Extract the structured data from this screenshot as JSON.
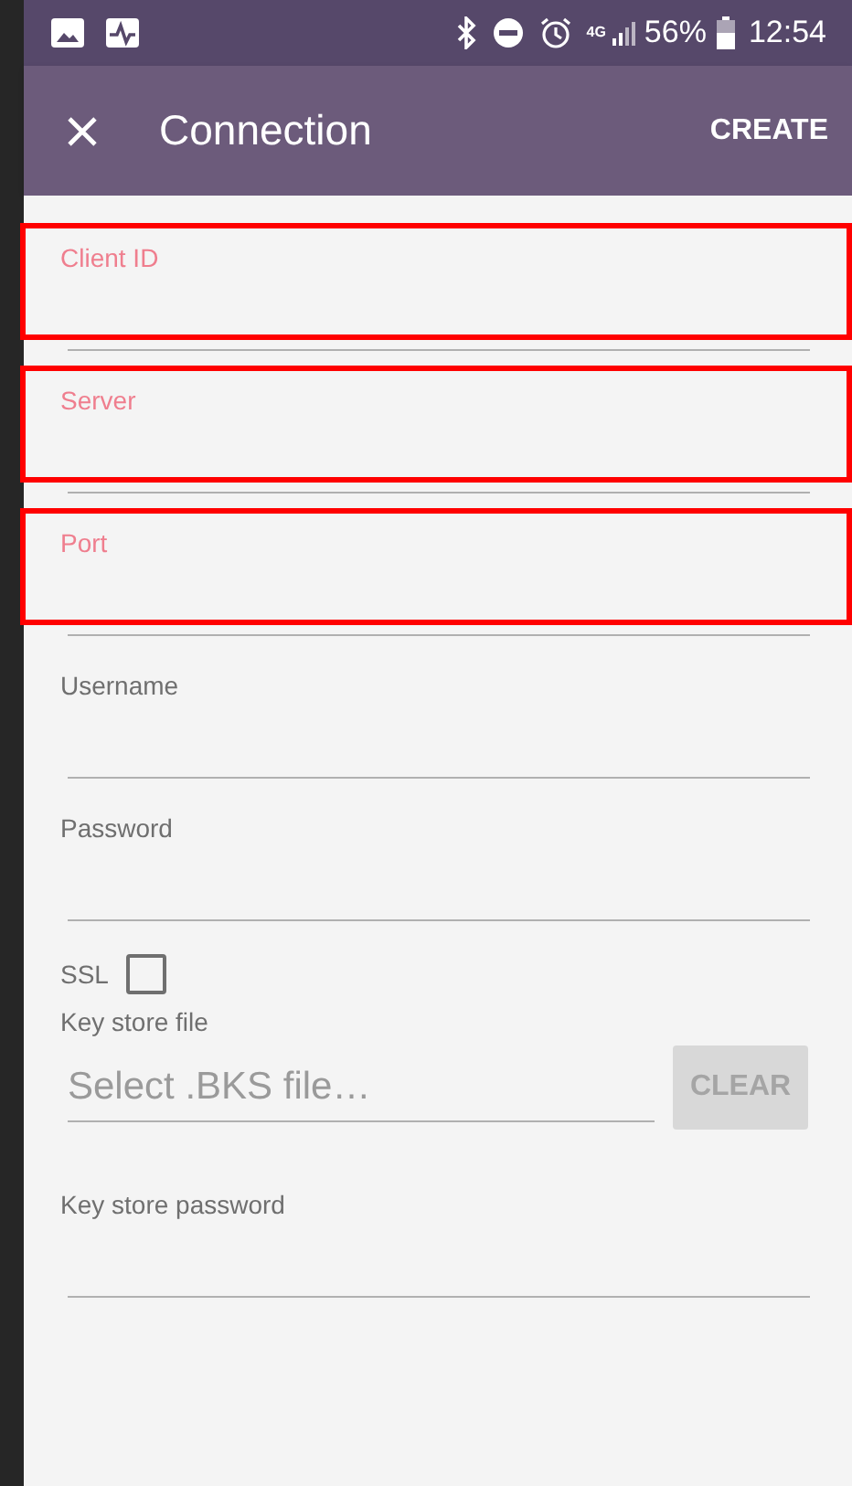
{
  "status_bar": {
    "network": "4G",
    "battery": "56%",
    "time": "12:54"
  },
  "toolbar": {
    "title": "Connection",
    "action": "CREATE"
  },
  "fields": [
    {
      "kind": "text",
      "label": "Client ID",
      "highlighted": true
    },
    {
      "kind": "text",
      "label": "Server",
      "highlighted": true
    },
    {
      "kind": "text",
      "label": "Port",
      "highlighted": true
    },
    {
      "kind": "text",
      "label": "Username",
      "highlighted": false
    },
    {
      "kind": "text",
      "label": "Password",
      "highlighted": false
    },
    {
      "kind": "checkbox",
      "label": "SSL",
      "checked": false
    },
    {
      "kind": "file",
      "label": "Key store file",
      "placeholder": "Select .BKS file…",
      "button": "CLEAR",
      "disabled": true
    },
    {
      "kind": "text",
      "label": "Key store password",
      "highlighted": false
    }
  ]
}
